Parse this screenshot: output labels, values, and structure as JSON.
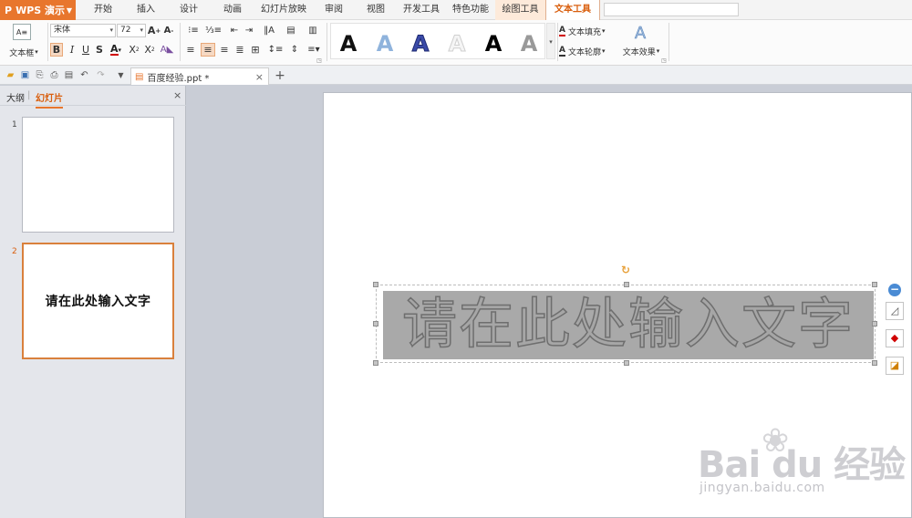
{
  "menubar": {
    "app_label": "WPS 演示",
    "app_logo": "P",
    "tabs": [
      "开始",
      "插入",
      "设计",
      "动画",
      "幻灯片放映",
      "审阅",
      "视图",
      "开发工具",
      "特色功能",
      "绘图工具",
      "文本工具"
    ],
    "active_tab": "文本工具",
    "contextual_tabs": [
      "绘图工具",
      "文本工具"
    ]
  },
  "ribbon": {
    "textbox_label": "文本框",
    "font_name": "宋体",
    "font_size": "72",
    "text_fill_label": "文本填充",
    "text_outline_label": "文本轮廓",
    "text_effect_label": "文本效果"
  },
  "doc_tab": {
    "title": "百度经验.ppt *"
  },
  "panel": {
    "outline_tab": "大纲",
    "slides_tab": "幻灯片",
    "slides": [
      {
        "number": "1",
        "text": ""
      },
      {
        "number": "2",
        "text": "请在此处输入文字"
      }
    ]
  },
  "slide": {
    "textbox_text": "请在此处输入文字"
  },
  "watermark": {
    "logo": "Bai du 经验",
    "url": "jingyan.baidu.com"
  },
  "colors": {
    "accent": "#e8762d",
    "active_text": "#d95f0e",
    "workspace_bg": "#c9cdd6",
    "textbox_fill": "#a9a9a9"
  }
}
